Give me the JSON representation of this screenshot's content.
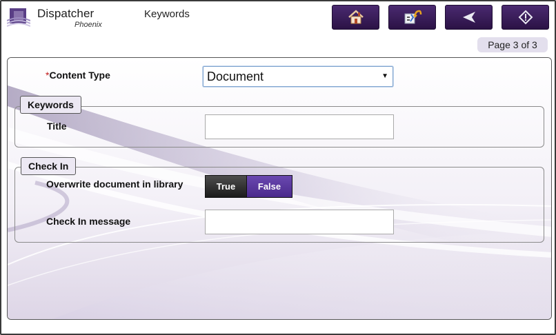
{
  "header": {
    "logo_name": "Dispatcher",
    "logo_sub": "Phoenix",
    "title": "Keywords",
    "buttons": [
      {
        "name": "home-button",
        "icon": "home-icon"
      },
      {
        "name": "reset-button",
        "icon": "form-undo-icon"
      },
      {
        "name": "back-button",
        "icon": "back-arrow-icon"
      },
      {
        "name": "start-button",
        "icon": "start-diamond-icon"
      }
    ]
  },
  "pagination": {
    "label": "Page 3 of 3"
  },
  "form": {
    "content_type": {
      "required_mark": "*",
      "label": "Content Type",
      "value": "Document",
      "caret": "▼"
    },
    "keywords_section": {
      "legend": "Keywords",
      "title_label": "Title",
      "title_value": ""
    },
    "checkin_section": {
      "legend": "Check In",
      "overwrite_label": "Overwrite document in library",
      "toggle_true": "True",
      "toggle_false": "False",
      "selected": "False",
      "message_label": "Check In message",
      "message_value": ""
    }
  },
  "colors": {
    "accent": "#4a2a8c",
    "button_bg": "#2b1245",
    "required": "#c01818"
  }
}
